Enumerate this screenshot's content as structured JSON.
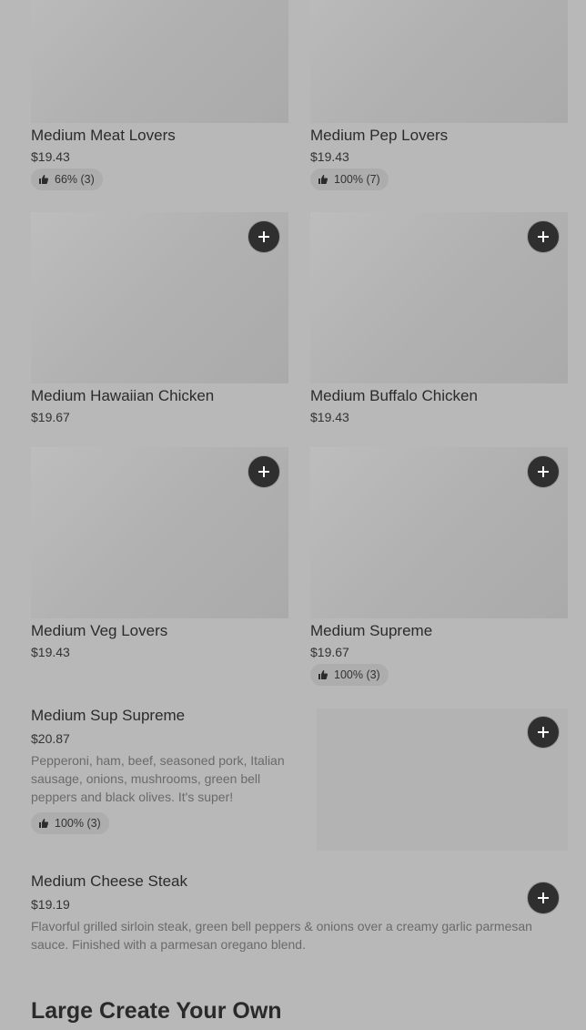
{
  "cards_top": [
    {
      "name": "Medium Meat Lovers",
      "price": "$19.43",
      "rating": "66% (3)"
    },
    {
      "name": "Medium Pep Lovers",
      "price": "$19.43",
      "rating": "100% (7)"
    }
  ],
  "cards_mid": [
    {
      "name": "Medium Hawaiian Chicken",
      "price": "$19.67"
    },
    {
      "name": "Medium Buffalo Chicken",
      "price": "$19.43"
    }
  ],
  "cards_low": [
    {
      "name": "Medium Veg Lovers",
      "price": "$19.43"
    },
    {
      "name": "Medium Supreme",
      "price": "$19.67",
      "rating": "100% (3)"
    }
  ],
  "sup_supreme": {
    "name": "Medium Sup Supreme",
    "price": "$20.87",
    "description": "Pepperoni, ham, beef, seasoned pork, Italian sausage, onions, mushrooms, green bell peppers and black olives. It's super!",
    "rating": "100% (3)"
  },
  "cheese_steak": {
    "name": "Medium Cheese Steak",
    "price": "$19.19",
    "description": "Flavorful grilled sirloin steak, green bell peppers & onions over a creamy garlic parmesan sauce. Finished with a parmesan oregano blend."
  },
  "section_title": "Large Create Your Own",
  "icons": {
    "add": "plus-icon",
    "rating": "thumbs-up-icon"
  }
}
